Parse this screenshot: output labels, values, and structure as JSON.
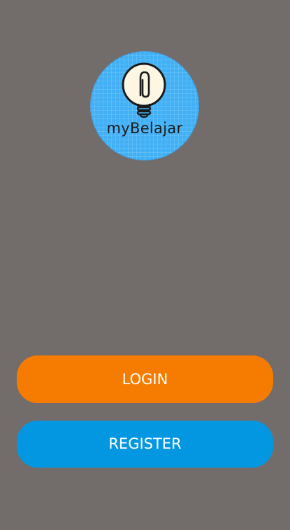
{
  "app": {
    "logo_text": "myBelajar"
  },
  "actions": {
    "login_label": "LOGIN",
    "register_label": "REGISTER"
  },
  "colors": {
    "background": "#726c6b",
    "logo_circle": "#42b0f5",
    "login_button": "#f57c00",
    "register_button": "#0397e1"
  },
  "icons": {
    "logo": "lightbulb-paperclip-icon"
  }
}
